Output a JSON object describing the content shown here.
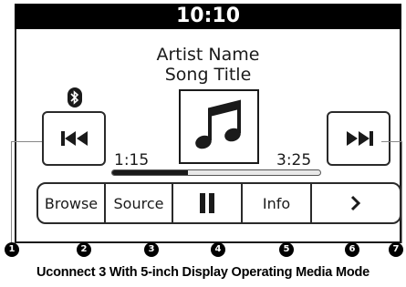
{
  "status": {
    "time": "10:10"
  },
  "now_playing": {
    "artist": "Artist Name",
    "song": "Song Title"
  },
  "progress": {
    "elapsed": "1:15",
    "total": "3:25",
    "fraction": 0.366
  },
  "icons": {
    "bluetooth": "bluetooth-icon",
    "album_art": "music-note-icon",
    "previous": "skip-previous-icon",
    "next": "skip-next-icon",
    "pause": "pause-icon",
    "more": "chevron-right-icon"
  },
  "buttons": {
    "browse": "Browse",
    "source": "Source",
    "info": "Info"
  },
  "callouts": [
    "1",
    "2",
    "3",
    "4",
    "5",
    "6",
    "7"
  ],
  "caption": "Uconnect 3 With 5-inch Display Operating Media Mode"
}
